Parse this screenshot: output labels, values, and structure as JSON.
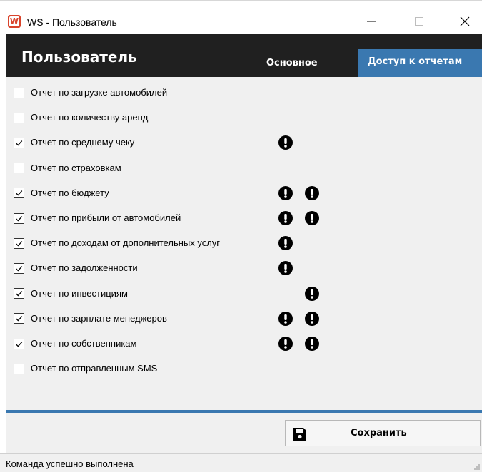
{
  "window": {
    "title": "WS - Пользователь",
    "icon_letter": "W"
  },
  "header": {
    "title": "Пользователь",
    "tabs": [
      {
        "label": "Основное",
        "active": false
      },
      {
        "label": "Доступ к отчетам",
        "active": true
      }
    ]
  },
  "reports": [
    {
      "label": "Отчет по загрузке автомобилей",
      "checked": false,
      "warnings": []
    },
    {
      "label": "Отчет по количеству аренд",
      "checked": false,
      "warnings": []
    },
    {
      "label": "Отчет по среднему чеку",
      "checked": true,
      "warnings": [
        1
      ]
    },
    {
      "label": "Отчет по страховкам",
      "checked": false,
      "warnings": []
    },
    {
      "label": "Отчет по бюджету",
      "checked": true,
      "warnings": [
        1,
        2
      ]
    },
    {
      "label": "Отчет по прибыли от автомобилей",
      "checked": true,
      "warnings": [
        1,
        2
      ]
    },
    {
      "label": "Отчет по доходам от дополнительных услуг",
      "checked": true,
      "warnings": [
        1
      ]
    },
    {
      "label": "Отчет по задолженности",
      "checked": true,
      "warnings": [
        1
      ]
    },
    {
      "label": "Отчет по инвестициям",
      "checked": true,
      "warnings": [
        2
      ]
    },
    {
      "label": "Отчет по зарплате менеджеров",
      "checked": true,
      "warnings": [
        1,
        2
      ]
    },
    {
      "label": "Отчет по собственникам",
      "checked": true,
      "warnings": [
        1,
        2
      ]
    },
    {
      "label": "Отчет по отправленным SMS",
      "checked": false,
      "warnings": []
    }
  ],
  "footer": {
    "save_label": "Сохранить"
  },
  "status": {
    "text": "Команда успешно выполнена"
  },
  "colors": {
    "header_bg": "#202020",
    "accent": "#3a78b0",
    "content_bg": "#f0f0f0",
    "app_icon": "#d9442c"
  },
  "icons": {
    "app": "app-logo-icon",
    "warning": "exclamation-circle-icon",
    "save": "floppy-disk-icon"
  }
}
